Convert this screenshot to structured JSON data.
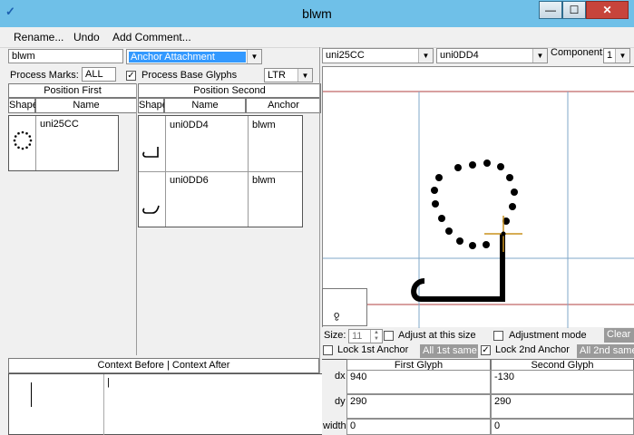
{
  "window": {
    "title": "blwm",
    "min_glyph": "—",
    "max_glyph": "☐",
    "close_glyph": "✕"
  },
  "menu": [
    "Rename...",
    "Undo",
    "Add Comment..."
  ],
  "left": {
    "name_value": "blwm",
    "type_value": "Anchor Attachment",
    "process_marks_label": "Process Marks:",
    "process_marks_value": "ALL",
    "process_base_label": "Process Base Glyphs",
    "direction_value": "LTR"
  },
  "first": {
    "title": "Position First",
    "col_shape": "Shape",
    "col_name": "Name",
    "rows": [
      {
        "name": "uni25CC"
      }
    ]
  },
  "second": {
    "title": "Position Second",
    "col_shape": "Shape",
    "col_name": "Name",
    "col_anchor": "Anchor",
    "rows": [
      {
        "name": "uni0DD4",
        "anchor": "blwm"
      },
      {
        "name": "uni0DD6",
        "anchor": "blwm"
      }
    ]
  },
  "context": {
    "title": "Context Before | Context After",
    "after_text": "|"
  },
  "preview": {
    "glyph1": "uni25CC",
    "glyph2": "uni0DD4",
    "component_label": "Component:",
    "component_value": "1",
    "mini_char": "ჹ",
    "size_label": "Size:",
    "size_value": "11",
    "adjust_label": "Adjust at this size",
    "adjust_mode_label": "Adjustment mode",
    "clear_label": "Clear",
    "lock1_label": "Lock 1st Anchor",
    "lock1_btn": "All 1st same",
    "lock2_label": "Lock 2nd Anchor",
    "lock2_btn": "All 2nd same"
  },
  "adjust_table": {
    "col_first": "First Glyph",
    "col_second": "Second Glyph",
    "rows": [
      {
        "label": "dx",
        "first": "940",
        "second": "-130"
      },
      {
        "label": "dy",
        "first": "290",
        "second": "290"
      },
      {
        "label": "width",
        "first": "0",
        "second": "0"
      }
    ]
  },
  "colors": {
    "titlebar": "#6fc0e8",
    "selection": "#3399ff",
    "guide_red": "#b04040",
    "guide_blue": "#7fa7c8",
    "anchor": "#c8901c"
  }
}
